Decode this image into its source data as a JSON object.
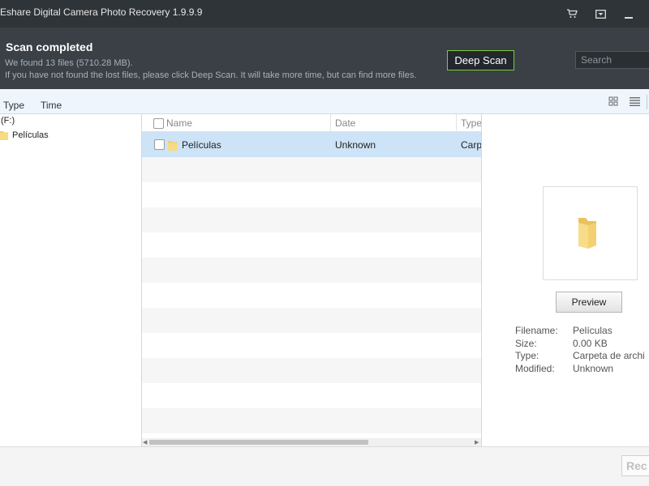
{
  "window": {
    "title": "Eshare Digital Camera Photo Recovery 1.9.9.9",
    "icons": [
      "cart-icon",
      "menu-icon",
      "minimize-icon"
    ]
  },
  "header": {
    "status_title": "Scan completed",
    "found_text": "We found 13 files (5710.28 MB).",
    "hint_text": "If you have not found the lost files, please click Deep Scan. It will take more time, but can find more files.",
    "deep_scan_label": "Deep Scan",
    "search_placeholder": "Search",
    "accent_color": "#7ccc3a"
  },
  "toolbar": {
    "tabs": [
      {
        "label": "Type"
      },
      {
        "label": "Time"
      }
    ],
    "view_icons": [
      "grid-view-icon",
      "list-view-icon"
    ]
  },
  "tree": {
    "drive_label": "(F:)",
    "folders": [
      {
        "label": "Películas"
      }
    ]
  },
  "file_list": {
    "columns": [
      "Name",
      "Date",
      "Type"
    ],
    "rows": [
      {
        "name": "Películas",
        "date": "Unknown",
        "type": "Carp",
        "selected": true
      }
    ],
    "selected_color": "#cde3f7"
  },
  "preview": {
    "button_label": "Preview",
    "info": [
      {
        "key": "Filename:",
        "value": "Películas"
      },
      {
        "key": "Size:",
        "value": "0.00 KB"
      },
      {
        "key": "Type:",
        "value": "Carpeta de archi"
      },
      {
        "key": "Modified:",
        "value": "Unknown"
      }
    ]
  },
  "bottom": {
    "recover_label": "Rec"
  }
}
